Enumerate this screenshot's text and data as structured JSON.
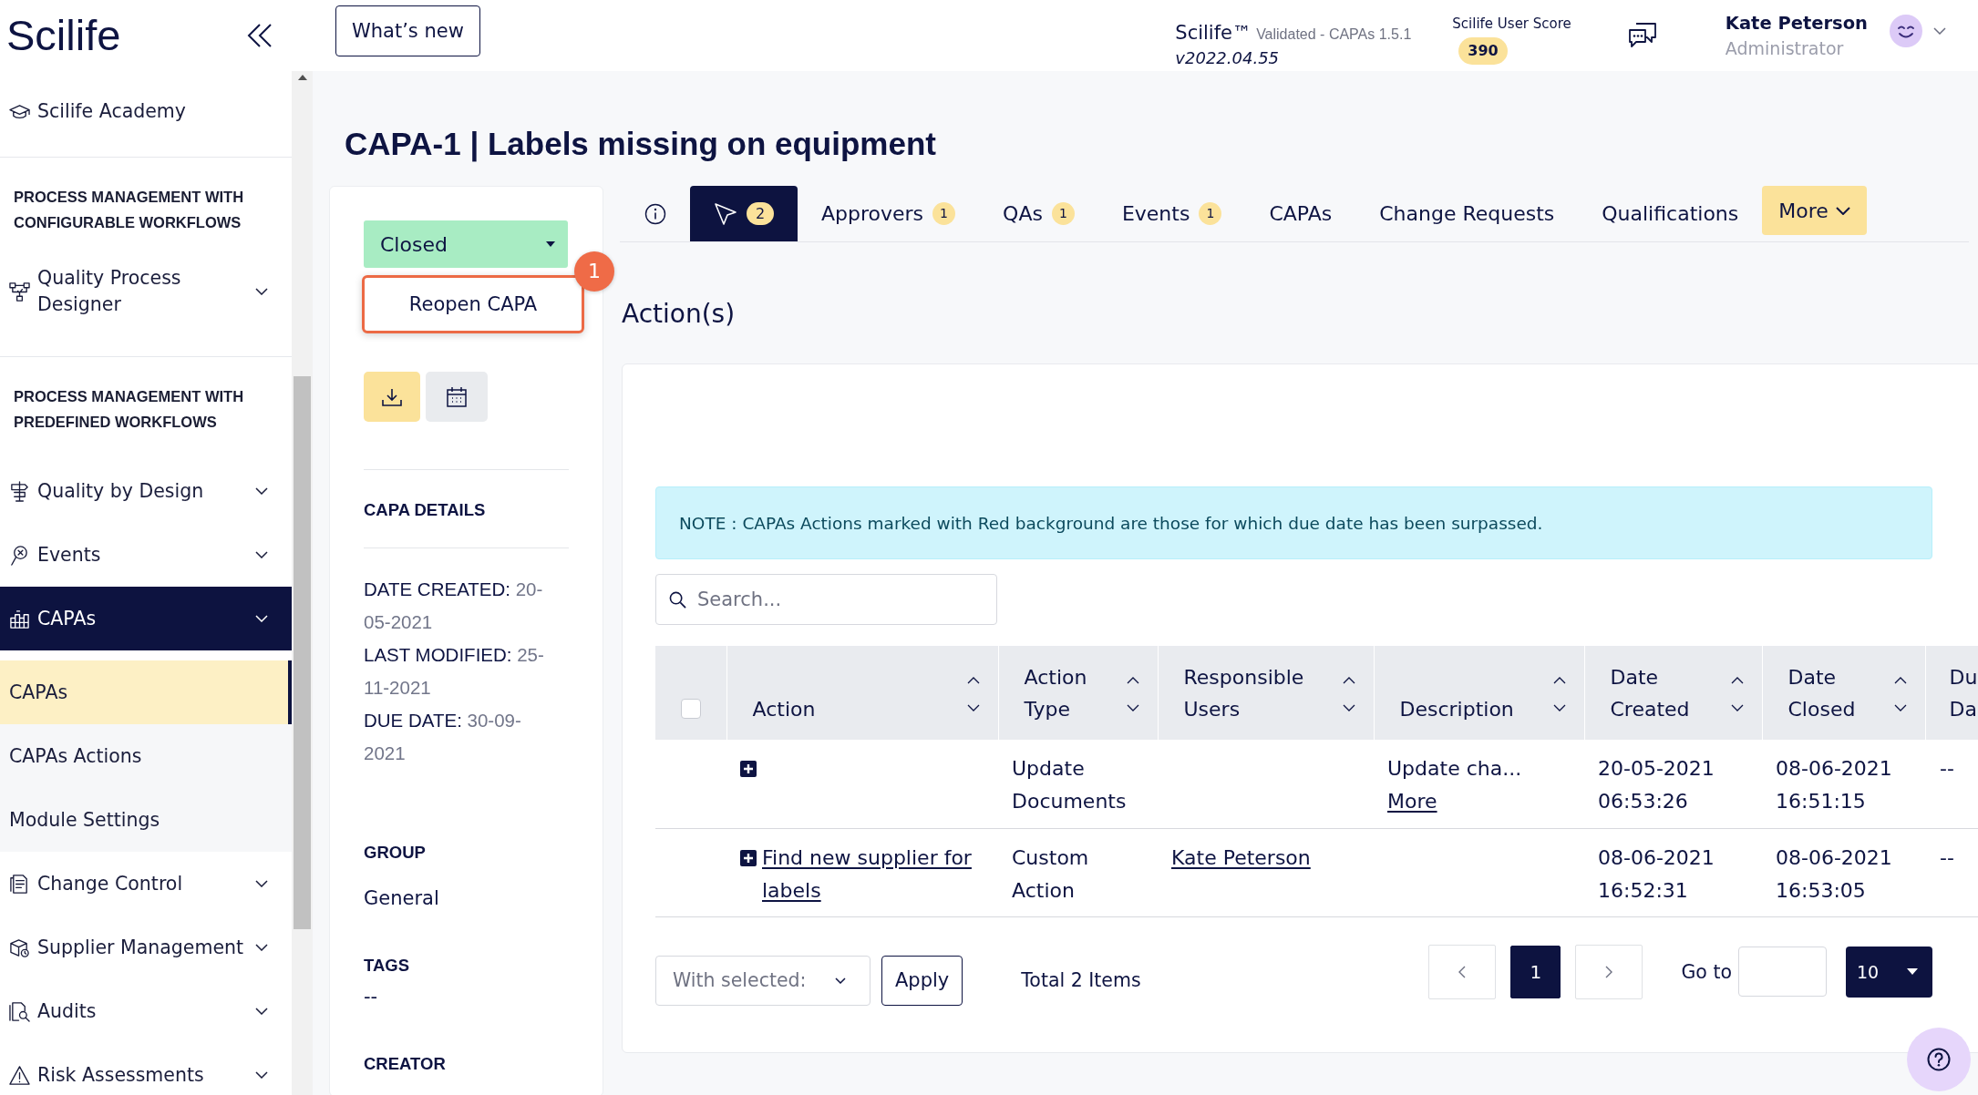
{
  "sidebar": {
    "logo": "Scilife",
    "sections": [
      {
        "items": [
          {
            "kind": "link",
            "label": "Scilife Academy"
          }
        ]
      },
      {
        "heading": "PROCESS MANAGEMENT WITH CONFIGURABLE WORKFLOWS",
        "items": [
          {
            "kind": "group",
            "label": "Quality Process Designer",
            "expanded": false
          }
        ]
      },
      {
        "heading": "PROCESS MANAGEMENT WITH PREDEFINED WORKFLOWS",
        "items": [
          {
            "kind": "group",
            "label": "Quality by Design",
            "expanded": false
          },
          {
            "kind": "group",
            "label": "Events",
            "expanded": false
          },
          {
            "kind": "group",
            "label": "CAPAs",
            "expanded": true,
            "children": [
              {
                "label": "CAPAs",
                "selected": true
              },
              {
                "label": "CAPAs Actions",
                "selected": false
              },
              {
                "label": "Module Settings",
                "selected": false
              }
            ]
          },
          {
            "kind": "group",
            "label": "Change Control",
            "expanded": false
          },
          {
            "kind": "group",
            "label": "Supplier Management",
            "expanded": false
          },
          {
            "kind": "group",
            "label": "Audits",
            "expanded": false
          },
          {
            "kind": "group",
            "label": "Risk Assessments",
            "expanded": false
          }
        ]
      }
    ]
  },
  "header": {
    "whats_new": "What’s new",
    "product": "Scilife™",
    "edition": "Validated - CAPAs 1.5.1",
    "version": "v2022.04.55",
    "score_label": "Scilife User Score",
    "score": "390",
    "user": {
      "name": "Kate Peterson",
      "role": "Administrator"
    }
  },
  "page": {
    "title": "CAPA-1 | Labels missing on equipment"
  },
  "details_panel": {
    "status": "Closed",
    "status_menu": {
      "items": [
        "Reopen CAPA"
      ],
      "step": "1"
    },
    "heading": "CAPA DETAILS",
    "dates": [
      {
        "label": "DATE CREATED:",
        "value": "20-05-2021"
      },
      {
        "label": "LAST MODIFIED:",
        "value": "25-11-2021"
      },
      {
        "label": "DUE DATE:",
        "value": "30-09-2021"
      }
    ],
    "fields": [
      {
        "label": "GROUP",
        "value": "General"
      },
      {
        "label": "TAGS",
        "value": "--"
      },
      {
        "label": "CREATOR"
      }
    ]
  },
  "tabs": [
    {
      "kind": "info",
      "selected": false
    },
    {
      "kind": "actions",
      "badge": "2",
      "selected": true
    },
    {
      "kind": "text",
      "label": "Approvers",
      "badge": "1",
      "selected": false
    },
    {
      "kind": "text",
      "label": "QAs",
      "badge": "1",
      "selected": false
    },
    {
      "kind": "text",
      "label": "Events",
      "badge": "1",
      "selected": false
    },
    {
      "kind": "text",
      "label": "CAPAs",
      "selected": false
    },
    {
      "kind": "text",
      "label": "Change Requests",
      "selected": false
    },
    {
      "kind": "text",
      "label": "Qualifications",
      "selected": false
    }
  ],
  "more_button": "More",
  "actions": {
    "title": "Action(s)",
    "note": "NOTE : CAPAs Actions marked with Red background are those for which due date has been surpassed.",
    "search": {
      "placeholder": "Search..."
    },
    "table": {
      "select_all": {
        "checked": false
      },
      "columns": [
        {
          "label": "Action",
          "sort": true
        },
        {
          "label": "Action Type",
          "sort": true
        },
        {
          "label": "Responsible Users",
          "sort": true
        },
        {
          "label": "Description",
          "sort": true
        },
        {
          "label": "Date Created",
          "sort": true
        },
        {
          "label": "Date Closed",
          "sort": true
        },
        {
          "label": "Du Da",
          "sort": false
        }
      ],
      "rows": [
        {
          "cells": [
            {
              "kind": "expander"
            },
            {
              "kind": "text",
              "text": "Update Documents"
            },
            {
              "kind": "empty"
            },
            {
              "kind": "more",
              "text": "Update cha...",
              "link": "More"
            },
            {
              "kind": "text",
              "text": "20-05-2021 06:53:26"
            },
            {
              "kind": "text",
              "text": "08-06-2021 16:51:15"
            },
            {
              "kind": "text",
              "text": "--"
            }
          ]
        },
        {
          "cells": [
            {
              "kind": "expander",
              "link": "Find new supplier for labels"
            },
            {
              "kind": "text",
              "text": "Custom Action"
            },
            {
              "kind": "link",
              "text": "Kate Peterson"
            },
            {
              "kind": "empty"
            },
            {
              "kind": "text",
              "text": "08-06-2021 16:52:31"
            },
            {
              "kind": "text",
              "text": "08-06-2021 16:53:05"
            },
            {
              "kind": "text",
              "text": "--"
            }
          ]
        }
      ]
    },
    "footer": {
      "bulk_action": "With selected:",
      "apply": "Apply",
      "total": "Total 2 Items",
      "pages": [
        {
          "label": "1",
          "selected": true
        }
      ],
      "goto_label": "Go to",
      "page_size": "10"
    }
  }
}
